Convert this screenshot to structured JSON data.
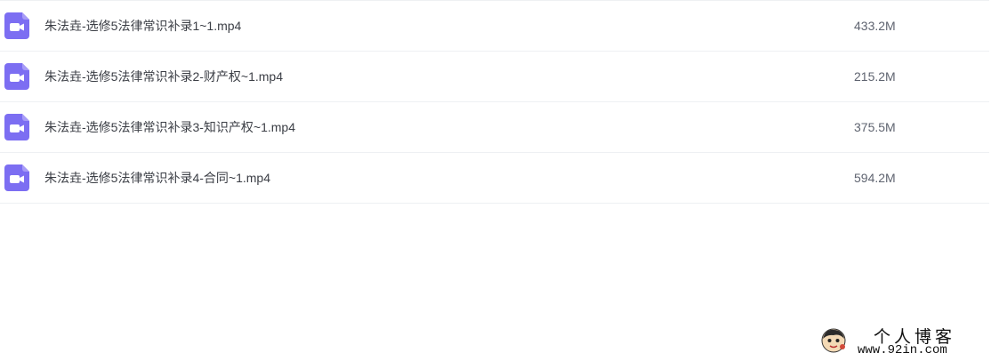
{
  "files": [
    {
      "name": "朱法垚-选修5法律常识补录1~1.mp4",
      "size": "433.2M",
      "icon": "video-file-icon"
    },
    {
      "name": "朱法垚-选修5法律常识补录2-财产权~1.mp4",
      "size": "215.2M",
      "icon": "video-file-icon"
    },
    {
      "name": "朱法垚-选修5法律常识补录3-知识产权~1.mp4",
      "size": "375.5M",
      "icon": "video-file-icon"
    },
    {
      "name": "朱法垚-选修5法律常识补录4-合同~1.mp4",
      "size": "594.2M",
      "icon": "video-file-icon"
    }
  ],
  "watermark": {
    "title": "个人博客",
    "url": "www.92in.com"
  },
  "colors": {
    "icon_accent": "#7c6ef2",
    "row_divider": "#eef0f3",
    "name_text": "#3b3e45",
    "size_text": "#5f6470"
  }
}
